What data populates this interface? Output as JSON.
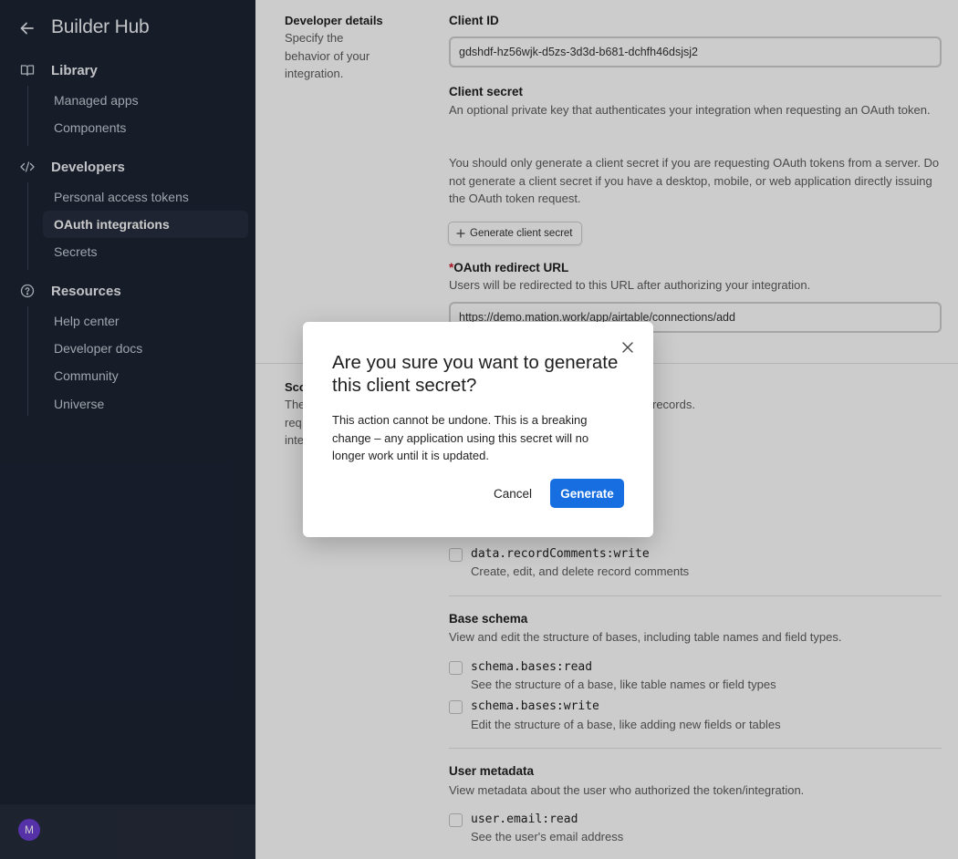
{
  "sidebar": {
    "title": "Builder Hub",
    "sections": [
      {
        "label": "Library",
        "icon": "book-icon",
        "items": [
          {
            "label": "Managed apps"
          },
          {
            "label": "Components"
          }
        ]
      },
      {
        "label": "Developers",
        "icon": "code-icon",
        "items": [
          {
            "label": "Personal access tokens"
          },
          {
            "label": "OAuth integrations",
            "active": true
          },
          {
            "label": "Secrets"
          }
        ]
      },
      {
        "label": "Resources",
        "icon": "help-circle-icon",
        "items": [
          {
            "label": "Help center"
          },
          {
            "label": "Developer docs"
          },
          {
            "label": "Community"
          },
          {
            "label": "Universe"
          }
        ]
      }
    ],
    "user_initial": "M"
  },
  "developer_details": {
    "title": "Developer details",
    "description": "Specify the behavior of your integration."
  },
  "client_id": {
    "label": "Client ID",
    "value": "gdshdf-hz56wjk-d5zs-3d3d-b681-dchfh46dsjsj2"
  },
  "client_secret": {
    "label": "Client secret",
    "description": "An optional private key that authenticates your integration when requesting an OAuth token.",
    "note": "You should only generate a client secret if you are requesting OAuth tokens from a server. Do not generate a client secret if you have a desktop, mobile, or web application directly issuing the OAuth token request.",
    "button_label": "Generate client secret"
  },
  "redirect": {
    "required_mark": "*",
    "label": "OAuth redirect URL",
    "description": "Users will be redirected to this URL after authorizing your integration.",
    "value": "https://demo.mation.work/app/airtable/connections/add"
  },
  "scopes": {
    "title_partial": "Sco",
    "desc_line1_partial": "The",
    "desc_line2_partial": "req",
    "desc_line3_partial": "inte",
    "right_partial": "records.",
    "record_comments_write": {
      "code": "data.recordComments:write",
      "desc": "Create, edit, and delete record comments"
    },
    "base_schema": {
      "title": "Base schema",
      "description": "View and edit the structure of bases, including table names and field types.",
      "items": [
        {
          "code": "schema.bases:read",
          "desc": "See the structure of a base, like table names or field types"
        },
        {
          "code": "schema.bases:write",
          "desc": "Edit the structure of a base, like adding new fields or tables"
        }
      ]
    },
    "user_metadata": {
      "title": "User metadata",
      "description": "View metadata about the user who authorized the token/integration.",
      "items": [
        {
          "code": "user.email:read",
          "desc": "See the user's email address"
        }
      ]
    }
  },
  "modal": {
    "title": "Are you sure you want to generate this client secret?",
    "body": "This action cannot be undone. This is a breaking change – any application using this secret will no longer work until it is updated.",
    "cancel_label": "Cancel",
    "confirm_label": "Generate"
  },
  "colors": {
    "sidebar_bg": "#1c2333",
    "primary": "#166ee1",
    "required": "#d11a2a",
    "avatar": "#6b3fd3"
  }
}
